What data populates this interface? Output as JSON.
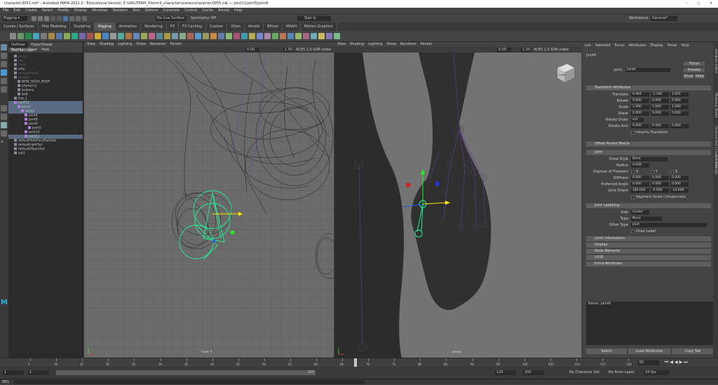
{
  "window": {
    "title": "character.0053.mb* - Autodesk MAYA 2022.3 - Educational Version: E:\\UAL\\TERM_3\\term3_character\\scenes\\character.0055.mb    ---  joint11|joint5|joint6"
  },
  "menubar": [
    "File",
    "Edit",
    "Create",
    "Select",
    "Modify",
    "Display",
    "Windows",
    "Skeleton",
    "Skin",
    "Deform",
    "Constrain",
    "Control",
    "Cache",
    "Arnold",
    "Help"
  ],
  "statusline": {
    "menuset": "Rigging",
    "live_surface": "No Live Surface",
    "symmetry": "Symmetry: Off",
    "sign_in": "Sign In",
    "workspace_label": "Workspace:",
    "workspace_value": "General*"
  },
  "shelf_tabs": [
    "Curves / Surfaces",
    "Poly Modeling",
    "Sculpting",
    "Rigging",
    "Animation",
    "Rendering",
    "FX",
    "FX Caching",
    "Custom",
    "XGen",
    "Arnold",
    "Bifrost",
    "MASH",
    "Motion Graphics"
  ],
  "outliner": {
    "tabs": [
      "Outliner",
      "HyperShade",
      "Tool Settings"
    ],
    "menu": [
      "Display",
      "Show",
      "Help"
    ],
    "rows": [
      {
        "label": "persp",
        "indent": 0,
        "dim": true,
        "sel": false
      },
      {
        "label": "top",
        "indent": 0,
        "dim": true,
        "sel": false
      },
      {
        "label": "front",
        "indent": 0,
        "dim": true,
        "sel": false
      },
      {
        "label": "side",
        "indent": 0,
        "dim": false,
        "sel": false
      },
      {
        "label": "imagePlane1",
        "indent": 0,
        "dim": true,
        "sel": false
      },
      {
        "label": "group1",
        "indent": 0,
        "dim": true,
        "sel": false
      },
      {
        "label": "NEW_HEAD_BODY",
        "indent": 1,
        "dim": false,
        "sel": false
      },
      {
        "label": "pSphere1",
        "indent": 1,
        "dim": false,
        "sel": false
      },
      {
        "label": "buttons",
        "indent": 1,
        "dim": false,
        "sel": false
      },
      {
        "label": "belt",
        "indent": 1,
        "dim": false,
        "sel": false
      },
      {
        "label": "Hat_1",
        "indent": 0,
        "dim": false,
        "sel": false
      },
      {
        "label": "joint11",
        "indent": 0,
        "dim": false,
        "sel": true
      },
      {
        "label": "joint2",
        "indent": 1,
        "dim": false,
        "sel": true
      },
      {
        "label": "joint3",
        "indent": 2,
        "dim": false,
        "sel": true
      },
      {
        "label": "joint4",
        "indent": 3,
        "dim": false,
        "sel": false
      },
      {
        "label": "joint8",
        "indent": 3,
        "dim": false,
        "sel": false
      },
      {
        "label": "joint9",
        "indent": 3,
        "dim": false,
        "sel": false
      },
      {
        "label": "joint5",
        "indent": 4,
        "dim": false,
        "sel": false
      },
      {
        "label": "joint10",
        "indent": 3,
        "dim": false,
        "sel": false
      },
      {
        "label": "joint11",
        "indent": 3,
        "dim": false,
        "sel": true
      },
      {
        "label": "defaultHideFaceDataSet",
        "indent": 0,
        "dim": false,
        "sel": false
      },
      {
        "label": "defaultLightSet",
        "indent": 0,
        "dim": false,
        "sel": false
      },
      {
        "label": "defaultObjectSet",
        "indent": 0,
        "dim": false,
        "sel": false
      },
      {
        "label": "set1",
        "indent": 0,
        "dim": false,
        "sel": false
      }
    ]
  },
  "viewport_front": {
    "menu": [
      "View",
      "Shading",
      "Lighting",
      "Show",
      "Renderer",
      "Panels"
    ],
    "label": "front -Y",
    "near": "0.00",
    "far": "1.00",
    "colorspace": "ACES 1.0 SDR-video"
  },
  "viewport_persp": {
    "menu": [
      "View",
      "Shading",
      "Lighting",
      "Show",
      "Renderer",
      "Panels"
    ],
    "label": "persp",
    "near": "0.00",
    "far": "1.00",
    "colorspace": "ACES 1.0 SDR-video",
    "viewcube": "FRONT"
  },
  "attribute_editor": {
    "menu": [
      "List",
      "Selected",
      "Focus",
      "Attributes",
      "Display",
      "Show",
      "Help"
    ],
    "node_tab": "joint6",
    "node_label": "joint:",
    "node_value": "joint6",
    "buttons": [
      "Focus",
      "Presets",
      "Show",
      "Hide"
    ],
    "sections": {
      "transform": "Transform Attributes",
      "offset": "Offset Parent Matrix",
      "joint": "Joint",
      "labelling": "Joint Labelling",
      "collapsed": [
        "Limit Information",
        "Display",
        "Node Behavior",
        "UUID",
        "Extra Attributes"
      ]
    },
    "translate": {
      "label": "Translate",
      "values": [
        "6.964",
        "-1.302",
        "2.051"
      ]
    },
    "rotate": {
      "label": "Rotate",
      "values": [
        "0.000",
        "0.000",
        "0.000"
      ]
    },
    "scale": {
      "label": "Scale",
      "values": [
        "1.000",
        "1.000",
        "1.000"
      ]
    },
    "shear": {
      "label": "Shear",
      "values": [
        "0.000",
        "0.000",
        "0.000"
      ]
    },
    "rotate_order": {
      "label": "Rotate Order",
      "value": "xyz"
    },
    "rotate_axis": {
      "label": "Rotate Axis",
      "values": [
        "0.000",
        "0.000",
        "0.000"
      ]
    },
    "inherits": "Inherits Transform",
    "draw_style": {
      "label": "Draw Style",
      "value": "Bone"
    },
    "radius": {
      "label": "Radius",
      "value": "0.936"
    },
    "dof": {
      "label": "Degrees of Freedom",
      "x": "X",
      "y": "Y",
      "z": "Z"
    },
    "stiffness": {
      "label": "Stiffness",
      "values": [
        "0.000",
        "0.000",
        "0.000"
      ]
    },
    "preferred_angle": {
      "label": "Preferred Angle",
      "values": [
        "0.000",
        "0.000",
        "0.000"
      ]
    },
    "joint_orient": {
      "label": "Joint Orient",
      "values": [
        "180.000",
        "-0.000",
        "-14.608"
      ]
    },
    "segment_scale": "Segment Scale Compensate",
    "side": {
      "label": "Side",
      "value": "Center"
    },
    "type": {
      "label": "Type",
      "value": "None"
    },
    "other_type": {
      "label": "Other Type",
      "value": "Joint"
    },
    "draw_label": "Draw Label",
    "notes_label": "Notes: joint6",
    "bottom_buttons": [
      "Select",
      "Load Attributes",
      "Copy Tab"
    ]
  },
  "side_tabs": [
    "Attribute Editor",
    "Modeling Toolkit",
    "Channel Box / Layer Editor",
    "Tool Settings"
  ],
  "timeline": {
    "current_frame": "65",
    "ticks": [
      "5",
      "10",
      "15",
      "20",
      "25",
      "30",
      "35",
      "40",
      "45",
      "50",
      "55",
      "60",
      "65",
      "70",
      "75",
      "80",
      "85",
      "90",
      "95",
      "100",
      "105",
      "110",
      "115",
      "120"
    ]
  },
  "range": {
    "start": "1",
    "anim_start": "1",
    "range_end_label": "120",
    "end": "120",
    "anim_end": "200",
    "character_set": "No Character Set",
    "anim_layer": "No Anim Layer",
    "fps": "24 fps"
  },
  "command_line": {
    "lang": "MEL"
  },
  "colors": {
    "accent": "#5285a6",
    "selection": "#5a6a80",
    "joint_selected": "#22ee99",
    "wire": "#1a1a1a",
    "joint_purple": "#6a3aa0"
  }
}
